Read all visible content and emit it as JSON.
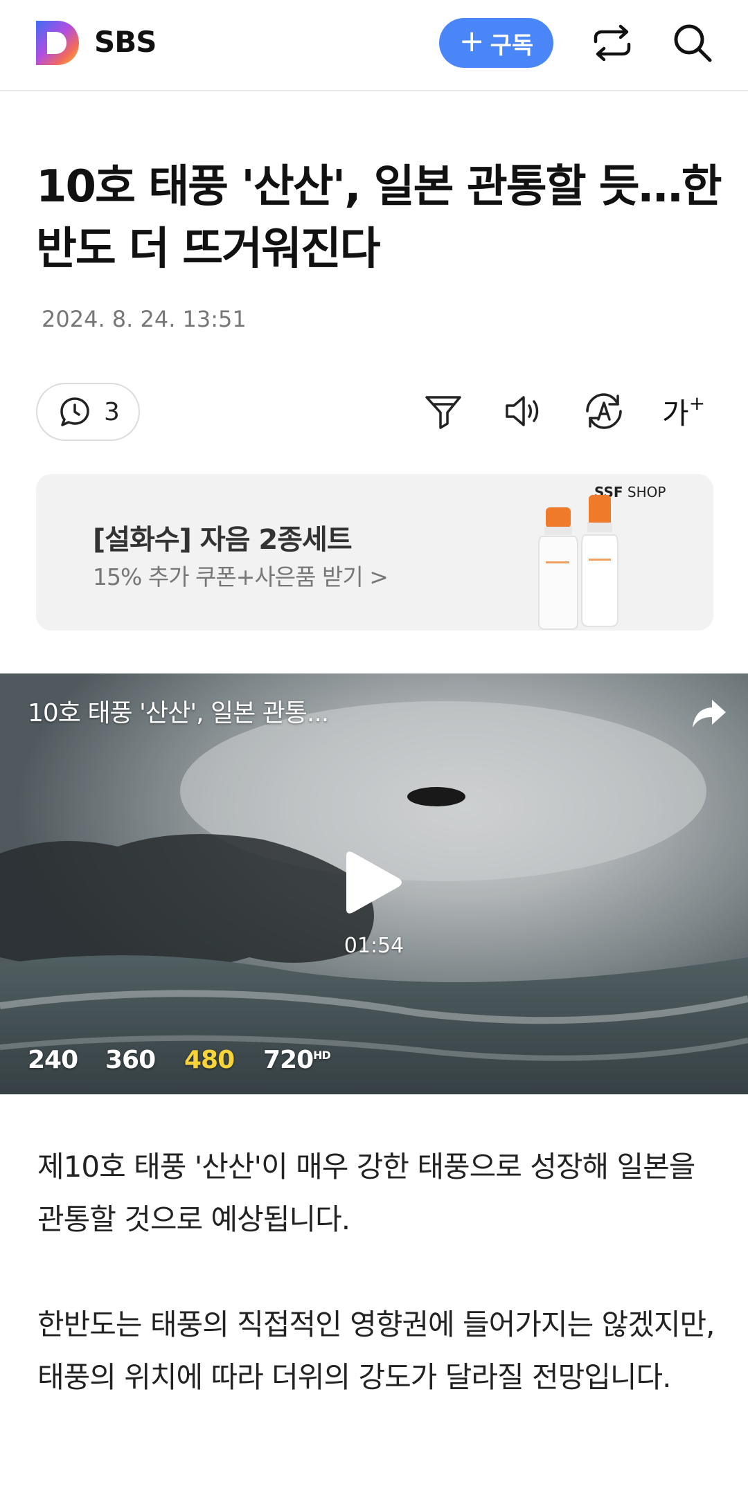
{
  "header": {
    "brand": "SBS",
    "subscribe_label": "구독",
    "subscribe_plus": "+"
  },
  "article": {
    "title": "10호 태풍 '산산', 일본 관통할 듯…한반도 더 뜨거워진다",
    "date": "2024. 8. 24. 13:51",
    "comment_count": "3",
    "font_size_label": "가"
  },
  "ad": {
    "title": "[설화수] 자음 2종세트",
    "subtitle": "15% 추가 쿠폰+사은품 받기 >",
    "shop_bold": "SSF",
    "shop_rest": " SHOP"
  },
  "video": {
    "title": "10호 태풍 '산산', 일본 관통...",
    "duration": "01:54",
    "qualities": [
      "240",
      "360",
      "480",
      "720"
    ],
    "hd_badge": "HD",
    "selected_quality": "480"
  },
  "body": {
    "paragraphs": [
      "제10호 태풍 '산산'이 매우 강한 태풍으로 성장해 일본을 관통할 것으로 예상됩니다.",
      "한반도는 태풍의 직접적인 영향권에 들어가지는 않겠지만, 태풍의 위치에 따라 더위의 강도가 달라질 전망입니다."
    ]
  },
  "colors": {
    "accent": "#4a86f7",
    "selected_quality": "#f7d43a",
    "ad_background": "#f2f2f2"
  },
  "icons": [
    "daum-logo-icon",
    "share-icon",
    "search-icon",
    "comment-icon",
    "summary-filter-icon",
    "speaker-icon",
    "translate-icon",
    "font-size-icon",
    "play-icon",
    "video-share-icon"
  ]
}
